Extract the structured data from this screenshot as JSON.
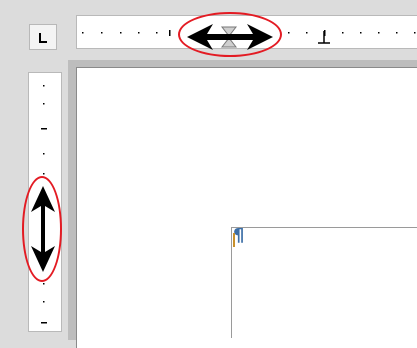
{
  "paragraph_mark": "¶",
  "icons": {
    "corner": "tab-stop-icon",
    "horizontal_handle": "double-arrow-horizontal-icon",
    "vertical_handle": "double-arrow-vertical-icon"
  },
  "colors": {
    "highlight": "#e31b23",
    "ruler_background": "#ffffff",
    "workspace": "#bdbdbd"
  }
}
